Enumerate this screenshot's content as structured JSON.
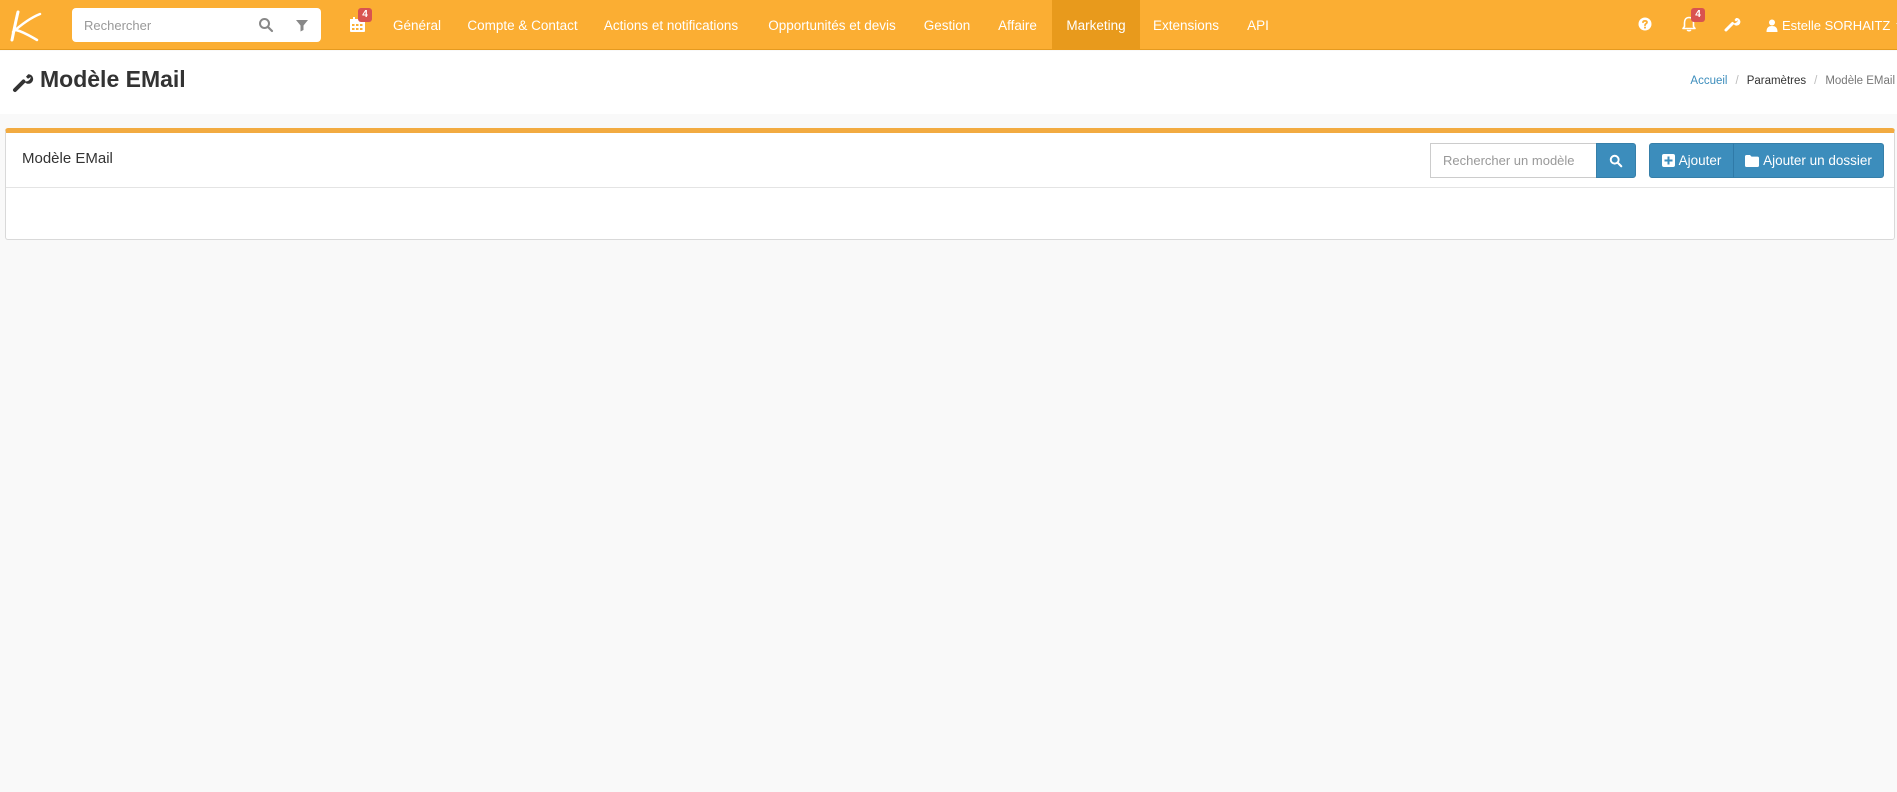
{
  "topbar": {
    "search_placeholder": "Rechercher",
    "calendar_badge": "4",
    "nav_items": [
      "Général",
      "Compte & Contact",
      "Actions et notifications",
      "Opportunités et devis",
      "Gestion",
      "Affaire",
      "Marketing",
      "Extensions",
      "API"
    ],
    "active_item": "Marketing",
    "notifications_badge": "4",
    "user_name": "Estelle SORHAITZ"
  },
  "header": {
    "title": "Modèle EMail",
    "breadcrumb": [
      "Accueil",
      "Paramètres",
      "Modèle EMail"
    ]
  },
  "box": {
    "title": "Modèle EMail",
    "search_placeholder": "Rechercher un modèle",
    "add_label": "Ajouter",
    "add_folder_label": "Ajouter un dossier"
  },
  "colors": {
    "navbar": "#fbae33",
    "navbar_active": "#e89a1c",
    "box_accent": "#f2ab41",
    "primary_button": "#3c8dbc",
    "badge": "#d9534f"
  }
}
